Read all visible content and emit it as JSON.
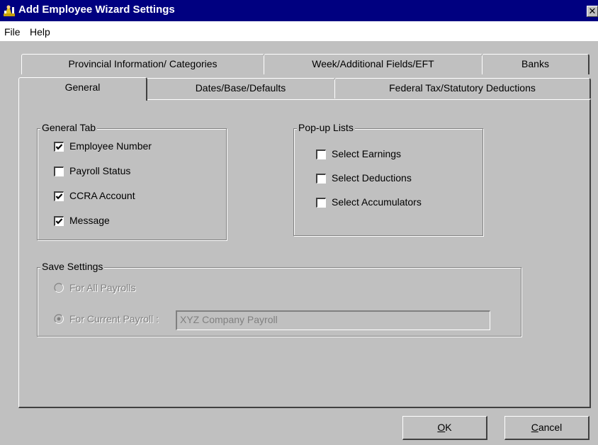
{
  "window": {
    "title": "Add Employee Wizard Settings",
    "close": "✕"
  },
  "menu": {
    "file": "File",
    "help": "Help"
  },
  "tabs": {
    "provincial": "Provincial Information/ Categories",
    "week": "Week/Additional Fields/EFT",
    "banks": "Banks",
    "general": "General",
    "dates": "Dates/Base/Defaults",
    "federal": "Federal Tax/Statutory Deductions"
  },
  "general_tab": {
    "label": "General Tab",
    "items": [
      {
        "label": "Employee Number",
        "checked": true
      },
      {
        "label": "Payroll Status",
        "checked": false
      },
      {
        "label": "CCRA Account",
        "checked": true
      },
      {
        "label": "Message",
        "checked": true
      }
    ]
  },
  "popup_lists": {
    "label": "Pop-up Lists",
    "items": [
      {
        "label": "Select Earnings",
        "checked": false
      },
      {
        "label": "Select Deductions",
        "checked": false
      },
      {
        "label": "Select Accumulators",
        "checked": false
      }
    ]
  },
  "save_settings": {
    "label": "Save Settings",
    "all_payrolls": "For All Payrolls",
    "current_payroll": "For Current Payroll :",
    "current_payroll_value": "XYZ Company Payroll",
    "selected": "current_payroll"
  },
  "buttons": {
    "ok_accel": "O",
    "ok_rest": "K",
    "cancel_accel": "C",
    "cancel_rest": "ancel"
  },
  "colors": {
    "titlebar": "#000080",
    "face": "#c0c0c0",
    "disabled_text": "#808080"
  }
}
